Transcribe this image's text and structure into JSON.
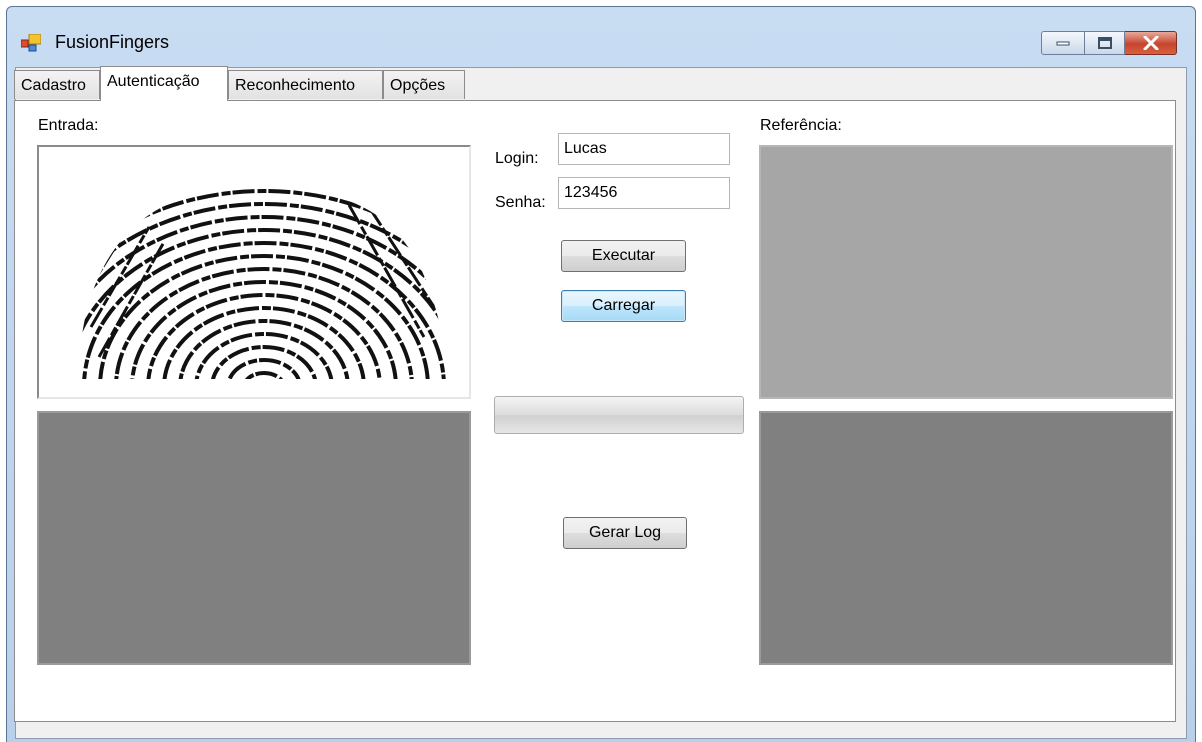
{
  "window": {
    "title": "FusionFingers",
    "icon": "application-icon",
    "controls": [
      "minimize-icon",
      "maximize-icon",
      "close-icon"
    ]
  },
  "tabs": [
    {
      "label": "Cadastro",
      "active": false
    },
    {
      "label": "Autenticação",
      "active": true
    },
    {
      "label": "Reconhecimento",
      "active": false
    },
    {
      "label": "Opções",
      "active": false
    }
  ],
  "auth": {
    "input_label": "Entrada:",
    "reference_label": "Referência:",
    "login_label": "Login:",
    "login_value": "Lucas",
    "password_label": "Senha:",
    "password_value": "123456",
    "execute_button": "Executar",
    "load_button": "Carregar",
    "log_button": "Gerar Log",
    "progress": 0
  },
  "images": {
    "input_fingerprint": "fingerprint-image",
    "input_processed_color": "#808080",
    "reference_top_color": "#a6a6a6",
    "reference_bottom_color": "#808080"
  },
  "colors": {
    "titlebar": "#c8dcf2",
    "close_button": "#c5452e",
    "panel_background": "#ffffff"
  }
}
